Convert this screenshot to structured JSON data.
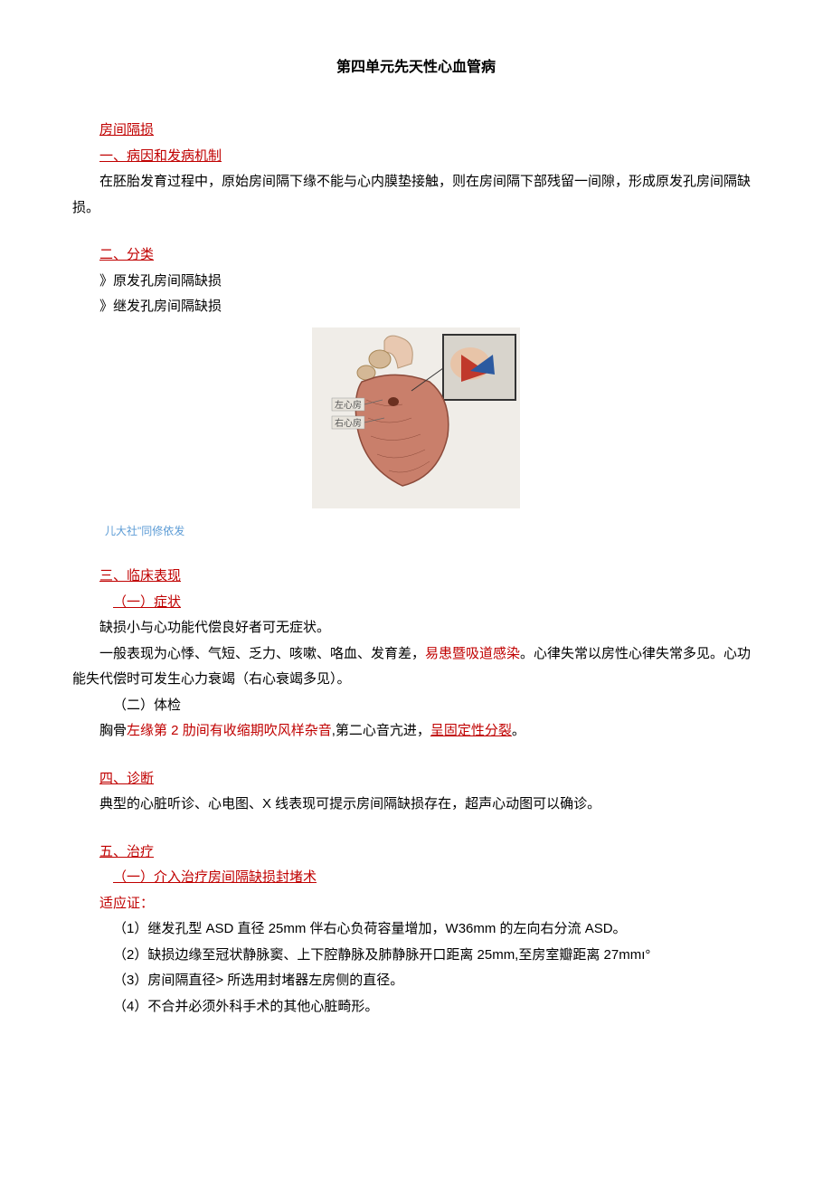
{
  "title": "第四单元先天性心血管病",
  "section1": {
    "heading": "房间隔损",
    "sub1": "一、病因和发病机制",
    "para1": "在胚胎发育过程中，原始房间隔下缘不能与心内膜垫接触，则在房间隔下部残留一间隙，形成原发孔房间隔缺损。"
  },
  "section2": {
    "heading": "二、分类",
    "item1": "》原发孔房间隔缺损",
    "item2": "》继发孔房间隔缺损",
    "caption": "儿大社\"同修依发",
    "label_left": "左心房",
    "label_right": "右心房"
  },
  "section3": {
    "heading": "三、临床表现",
    "sub1": "（一）症状",
    "para1": "缺损小与心功能代偿良好者可无症状。",
    "para2_a": "一般表现为心悸、气短、乏力、咳嗽、咯血、发育差，",
    "para2_b": "易患暨吸道感染",
    "para2_c": "。心律失常以房性心律失常多见。心功能失代偿时可发生心力衰竭（右心衰竭多见）。",
    "sub2": "（二）体检",
    "para3_a": "胸骨",
    "para3_b": "左缘第 2 肋间有收缩期吹风样杂音",
    "para3_c": ",第二心音亢进，",
    "para3_d": "呈固定性分裂",
    "para3_e": "。"
  },
  "section4": {
    "heading": "四、诊断",
    "para1": "典型的心脏听诊、心电图、X 线表现可提示房间隔缺损存在，超声心动图可以确诊。"
  },
  "section5": {
    "heading": "五、治疗",
    "sub1": "（一）介入治疗房间隔缺损封堵术",
    "sub2": "适应证：",
    "item1": "（1）继发孔型 ASD 直径 25mm 伴右心负荷容量增加，W36mm 的左向右分流 ASD。",
    "item2": "（2）缺损边缘至冠状静脉窦、上下腔静脉及肺静脉开口距离 25mm,至房室瓣距离 27mmı°",
    "item3": "（3）房间隔直径> 所选用封堵器左房侧的直径。",
    "item4": "（4）不合并必须外科手术的其他心脏畸形。"
  }
}
